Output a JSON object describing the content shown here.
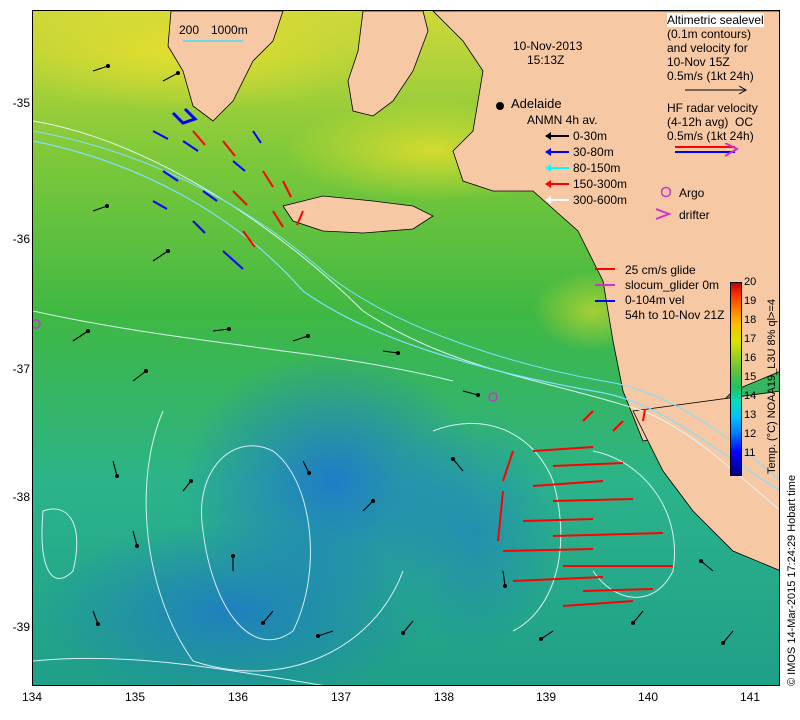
{
  "map": {
    "date": "10-Nov-2013",
    "time": "15:13Z",
    "scale_labels": [
      "200",
      "1000m"
    ],
    "place_label": "Adelaide",
    "lat_ticks": [
      "-35",
      "-36",
      "-37",
      "-38",
      "-39"
    ],
    "lon_ticks": [
      "134",
      "135",
      "136",
      "137",
      "138",
      "139",
      "140",
      "141"
    ]
  },
  "legend": {
    "altimetry_lines": [
      "Altimetric sealevel",
      "(0.1m contours)",
      "and velocity for",
      "10-Nov 15Z",
      "0.5m/s (1kt 24h)"
    ],
    "hf_lines": [
      "HF radar velocity",
      "(4-12h avg)",
      "0.5m/s (1kt 24h)"
    ],
    "hf_obscured": "OC",
    "anmn_title": "ANMN 4h av.",
    "anmn_items": [
      {
        "label": "0-30m",
        "color": "#000000"
      },
      {
        "label": "30-80m",
        "color": "#0000ff"
      },
      {
        "label": "80-150m",
        "color": "#00ffff"
      },
      {
        "label": "150-300m",
        "color": "#ff0000"
      },
      {
        "label": "300-600m",
        "color": "#ffffff"
      }
    ],
    "argo": "Argo",
    "drifter": "drifter",
    "glider_lines": [
      "25 cm/s glide",
      "slocum_glider 0m",
      "0-104m vel",
      "54h to 10-Nov 21Z"
    ]
  },
  "colorbar": {
    "ticks": [
      "20",
      "19",
      "18",
      "17",
      "16",
      "15",
      "14",
      "13",
      "12",
      "11"
    ],
    "label": "Temp. (°C) NOAA19_L3U 8% ql>=4"
  },
  "credit": "© IMOS 14-Mar-2015 17:24:29 Hobart time",
  "colors": {
    "land": "#f6c9a4",
    "sea_warm": "#e6d52c",
    "sea_mid": "#4fbf3c",
    "sea_cool": "#22b89c",
    "sea_cold": "#1e7fd8",
    "arrow_red": "#ff0000",
    "arrow_blue": "#0000ff",
    "argo": "#cc33cc"
  }
}
